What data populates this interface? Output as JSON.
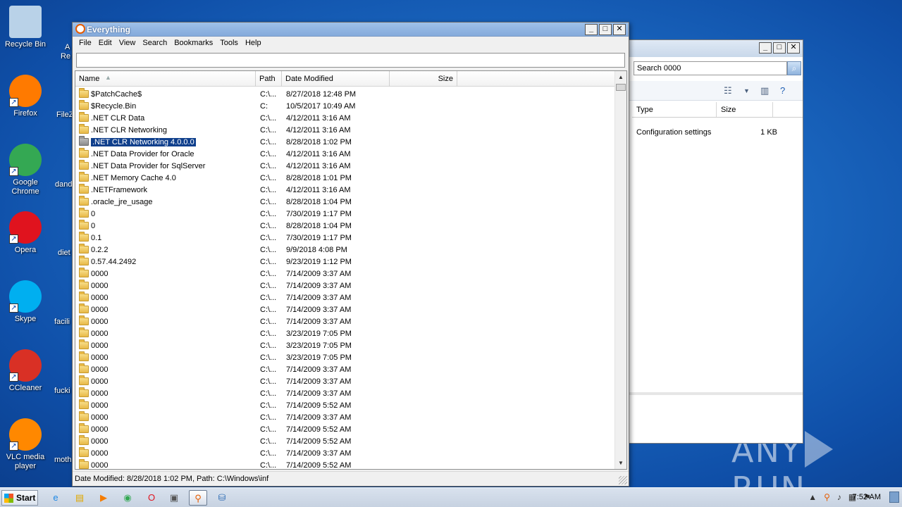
{
  "desktop": {
    "icons": [
      {
        "label": "Recycle Bin",
        "icon": "recycle-bin-icon",
        "color": "#b9d2e8"
      },
      {
        "label": "Firefox",
        "icon": "firefox-icon",
        "color": "#ff7a00"
      },
      {
        "label": "Google Chrome",
        "icon": "chrome-icon",
        "color": "#34a853"
      },
      {
        "label": "Opera",
        "icon": "opera-icon",
        "color": "#e0131e"
      },
      {
        "label": "Skype",
        "icon": "skype-icon",
        "color": "#00aff0"
      },
      {
        "label": "CCleaner",
        "icon": "ccleaner-icon",
        "color": "#d93025"
      },
      {
        "label": "VLC media player",
        "icon": "vlc-icon",
        "color": "#ff8800"
      }
    ],
    "partial_labels": [
      "A",
      "Re",
      "FileZ",
      "dand",
      "diet",
      "facili",
      "fucki",
      "moth"
    ],
    "watermark": "ANY RUN"
  },
  "bg_window": {
    "search_placeholder": "Search 0000",
    "col_type": "Type",
    "col_size": "Size",
    "row_type": "Configuration settings",
    "row_size": "1 KB"
  },
  "everything": {
    "title": "Everything",
    "menu": [
      "File",
      "Edit",
      "View",
      "Search",
      "Bookmarks",
      "Tools",
      "Help"
    ],
    "search_value": "",
    "columns": {
      "name": "Name",
      "path": "Path",
      "date": "Date Modified",
      "size": "Size"
    },
    "rows": [
      {
        "name": "$PatchCache$",
        "path": "C:\\...",
        "date": "8/27/2018 12:48 PM"
      },
      {
        "name": "$Recycle.Bin",
        "path": "C:",
        "date": "10/5/2017 10:49 AM"
      },
      {
        "name": ".NET CLR Data",
        "path": "C:\\...",
        "date": "4/12/2011 3:16 AM"
      },
      {
        "name": ".NET CLR Networking",
        "path": "C:\\...",
        "date": "4/12/2011 3:16 AM"
      },
      {
        "name": ".NET CLR Networking 4.0.0.0",
        "path": "C:\\...",
        "date": "8/28/2018 1:02 PM",
        "selected": true
      },
      {
        "name": ".NET Data Provider for Oracle",
        "path": "C:\\...",
        "date": "4/12/2011 3:16 AM"
      },
      {
        "name": ".NET Data Provider for SqlServer",
        "path": "C:\\...",
        "date": "4/12/2011 3:16 AM"
      },
      {
        "name": ".NET Memory Cache 4.0",
        "path": "C:\\...",
        "date": "8/28/2018 1:01 PM"
      },
      {
        "name": ".NETFramework",
        "path": "C:\\...",
        "date": "4/12/2011 3:16 AM"
      },
      {
        "name": ".oracle_jre_usage",
        "path": "C:\\...",
        "date": "8/28/2018 1:04 PM"
      },
      {
        "name": "0",
        "path": "C:\\...",
        "date": "7/30/2019 1:17 PM"
      },
      {
        "name": "0",
        "path": "C:\\...",
        "date": "8/28/2018 1:04 PM"
      },
      {
        "name": "0.1",
        "path": "C:\\...",
        "date": "7/30/2019 1:17 PM"
      },
      {
        "name": "0.2.2",
        "path": "C:\\...",
        "date": "9/9/2018 4:08 PM"
      },
      {
        "name": "0.57.44.2492",
        "path": "C:\\...",
        "date": "9/23/2019 1:12 PM"
      },
      {
        "name": "0000",
        "path": "C:\\...",
        "date": "7/14/2009 3:37 AM"
      },
      {
        "name": "0000",
        "path": "C:\\...",
        "date": "7/14/2009 3:37 AM"
      },
      {
        "name": "0000",
        "path": "C:\\...",
        "date": "7/14/2009 3:37 AM"
      },
      {
        "name": "0000",
        "path": "C:\\...",
        "date": "7/14/2009 3:37 AM"
      },
      {
        "name": "0000",
        "path": "C:\\...",
        "date": "7/14/2009 3:37 AM"
      },
      {
        "name": "0000",
        "path": "C:\\...",
        "date": "3/23/2019 7:05 PM"
      },
      {
        "name": "0000",
        "path": "C:\\...",
        "date": "3/23/2019 7:05 PM"
      },
      {
        "name": "0000",
        "path": "C:\\...",
        "date": "3/23/2019 7:05 PM"
      },
      {
        "name": "0000",
        "path": "C:\\...",
        "date": "7/14/2009 3:37 AM"
      },
      {
        "name": "0000",
        "path": "C:\\...",
        "date": "7/14/2009 3:37 AM"
      },
      {
        "name": "0000",
        "path": "C:\\...",
        "date": "7/14/2009 3:37 AM"
      },
      {
        "name": "0000",
        "path": "C:\\...",
        "date": "7/14/2009 5:52 AM"
      },
      {
        "name": "0000",
        "path": "C:\\...",
        "date": "7/14/2009 3:37 AM"
      },
      {
        "name": "0000",
        "path": "C:\\...",
        "date": "7/14/2009 5:52 AM"
      },
      {
        "name": "0000",
        "path": "C:\\...",
        "date": "7/14/2009 5:52 AM"
      },
      {
        "name": "0000",
        "path": "C:\\...",
        "date": "7/14/2009 3:37 AM"
      },
      {
        "name": "0000",
        "path": "C:\\...",
        "date": "7/14/2009 5:52 AM"
      }
    ],
    "status": "Date Modified: 8/28/2018 1:02 PM, Path: C:\\Windows\\inf"
  },
  "taskbar": {
    "start_label": "Start",
    "items": [
      {
        "icon": "ie-icon",
        "glyph": "e",
        "color": "#1e88e5"
      },
      {
        "icon": "explorer-icon",
        "glyph": "▤",
        "color": "#e0a800"
      },
      {
        "icon": "media-player-icon",
        "glyph": "▶",
        "color": "#f57c00"
      },
      {
        "icon": "chrome-icon",
        "glyph": "◉",
        "color": "#34a853"
      },
      {
        "icon": "opera-icon",
        "glyph": "O",
        "color": "#e0131e"
      },
      {
        "icon": "window-icon",
        "glyph": "▣",
        "color": "#555555"
      },
      {
        "icon": "everything-icon",
        "glyph": "⚲",
        "color": "#e55b00",
        "active": true
      },
      {
        "icon": "network-icon",
        "glyph": "⛁",
        "color": "#2f6db5"
      }
    ],
    "clock": "7:52 AM"
  }
}
